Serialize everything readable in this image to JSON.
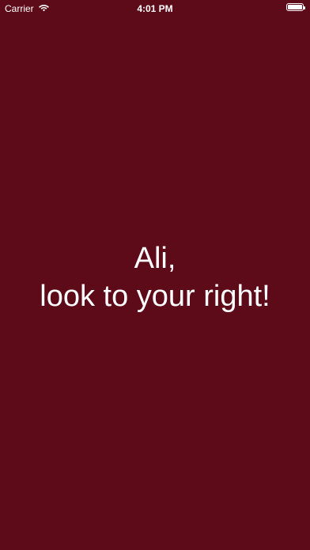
{
  "status_bar": {
    "carrier": "Carrier",
    "time": "4:01 PM",
    "wifi_icon": "wifi-icon",
    "battery_icon": "battery-icon",
    "battery_level": 1.0
  },
  "message": {
    "line1": "Ali,",
    "line2": "look to your right!"
  },
  "colors": {
    "background": "#5e0b19",
    "text": "#ffffff"
  }
}
